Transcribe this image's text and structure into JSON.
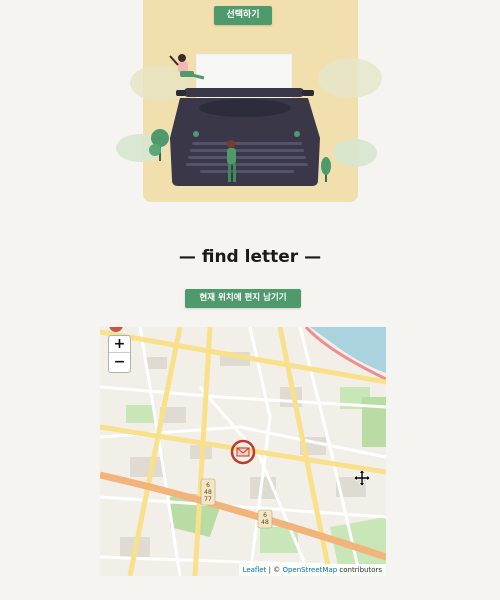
{
  "header": {
    "select_button_label": "선택하기"
  },
  "section": {
    "title": "— find letter —",
    "leave_letter_button_label": "현재 위치에 편지 남기기"
  },
  "map": {
    "zoom_in_label": "+",
    "zoom_out_label": "−",
    "attribution_leaflet": "Leaflet",
    "attribution_separator": " | © ",
    "attribution_osm": "OpenStreetMap",
    "attribution_suffix": " contributors",
    "route_shields": [
      "6\n48\n77",
      "6\n48"
    ],
    "colors": {
      "background": "#f2efe9",
      "major_road": "#f9e08a",
      "arterial_road": "#f2b47a",
      "park": "#b9dca4",
      "water": "#aad3df",
      "marker": "#c0392b"
    }
  },
  "illustration": {
    "icon": "typewriter-illustration",
    "colors": {
      "card": "#f2dfae",
      "typewriter": "#3a3848",
      "accent_green": "#4e9a6d"
    }
  }
}
